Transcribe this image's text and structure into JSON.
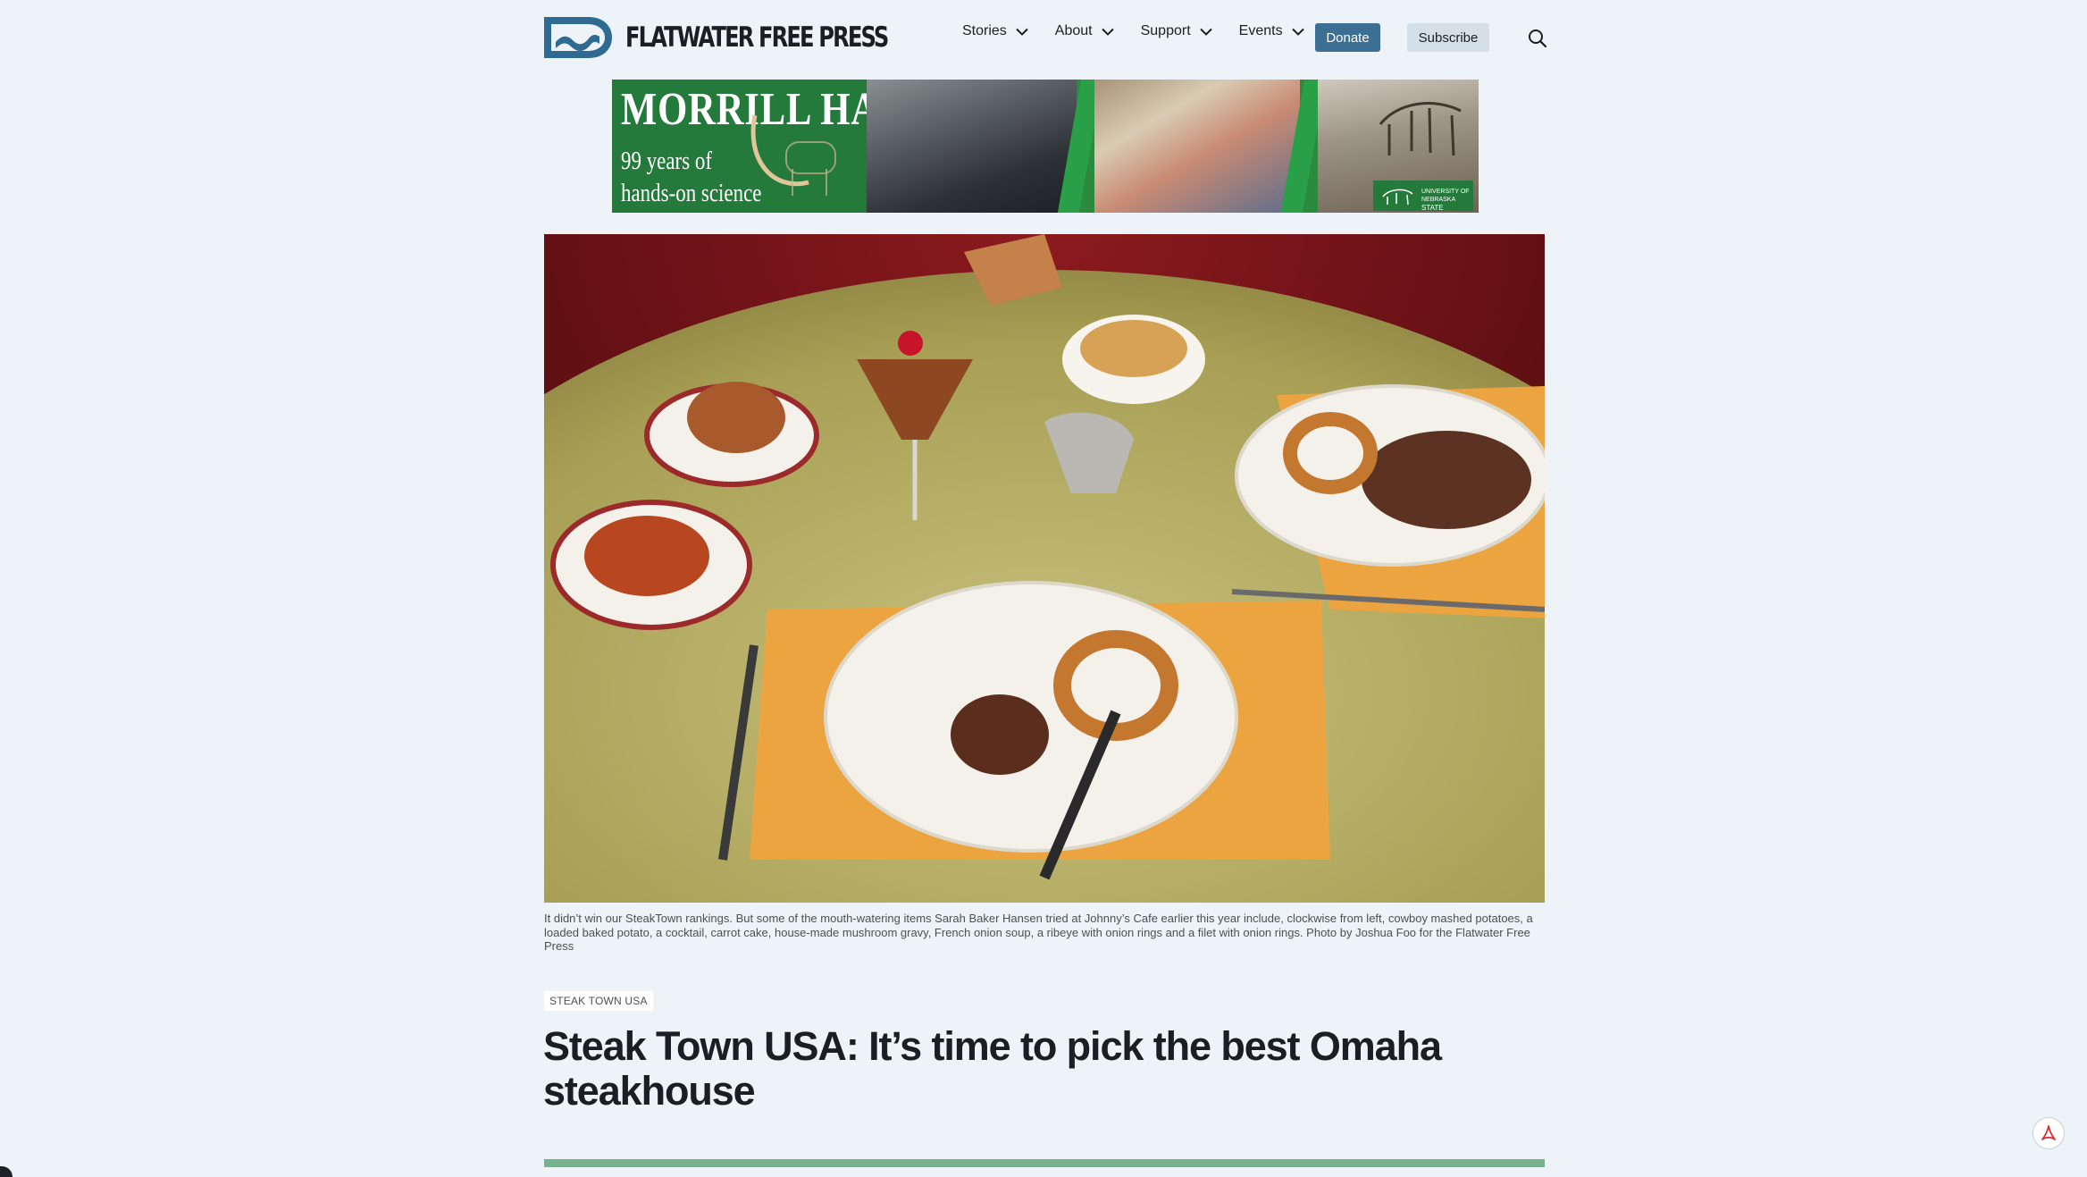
{
  "site": {
    "name": "FLATWATER FREE PRESS",
    "logo_icon": "flatwater-logo-mark"
  },
  "nav": {
    "items": [
      {
        "label": "Stories",
        "icon": "chevron-down-icon"
      },
      {
        "label": "About",
        "icon": "chevron-down-icon"
      },
      {
        "label": "Support",
        "icon": "chevron-down-icon"
      },
      {
        "label": "Events",
        "icon": "chevron-down-icon"
      }
    ],
    "donate_label": "Donate",
    "subscribe_label": "Subscribe",
    "search_icon": "search-icon"
  },
  "ad": {
    "title": "MORRILL HALL",
    "line1": "99 years of",
    "line2": "hands-on science",
    "badge_line1": "UNIVERSITY OF NEBRASKA",
    "badge_line2": "STATE MUSEUM"
  },
  "article": {
    "caption": "It didn’t win our SteakTown rankings. But some of the mouth-watering items Sarah Baker Hansen tried at Johnny’s Cafe earlier this year include, clockwise from left, cowboy mashed potatoes, a loaded baked potato, a cocktail, carrot cake, house-made mushroom gravy, French onion soup, a ribeye with onion rings and a filet with onion rings. Photo by Joshua Foo for the Flatwater Free Press",
    "category": "STEAK TOWN USA",
    "headline": "Steak Town USA: It’s time to pick the best Omaha steakhouse"
  },
  "colors": {
    "background": "#eef3f7",
    "donate": "#3d6e94",
    "subscribe": "#d4dfe8",
    "divider": "#74b38c",
    "logo_blue": "#2f6a93",
    "ad_green": "#237a3a"
  },
  "widgets": {
    "pdf_icon": "acrobat-pdf-icon"
  }
}
